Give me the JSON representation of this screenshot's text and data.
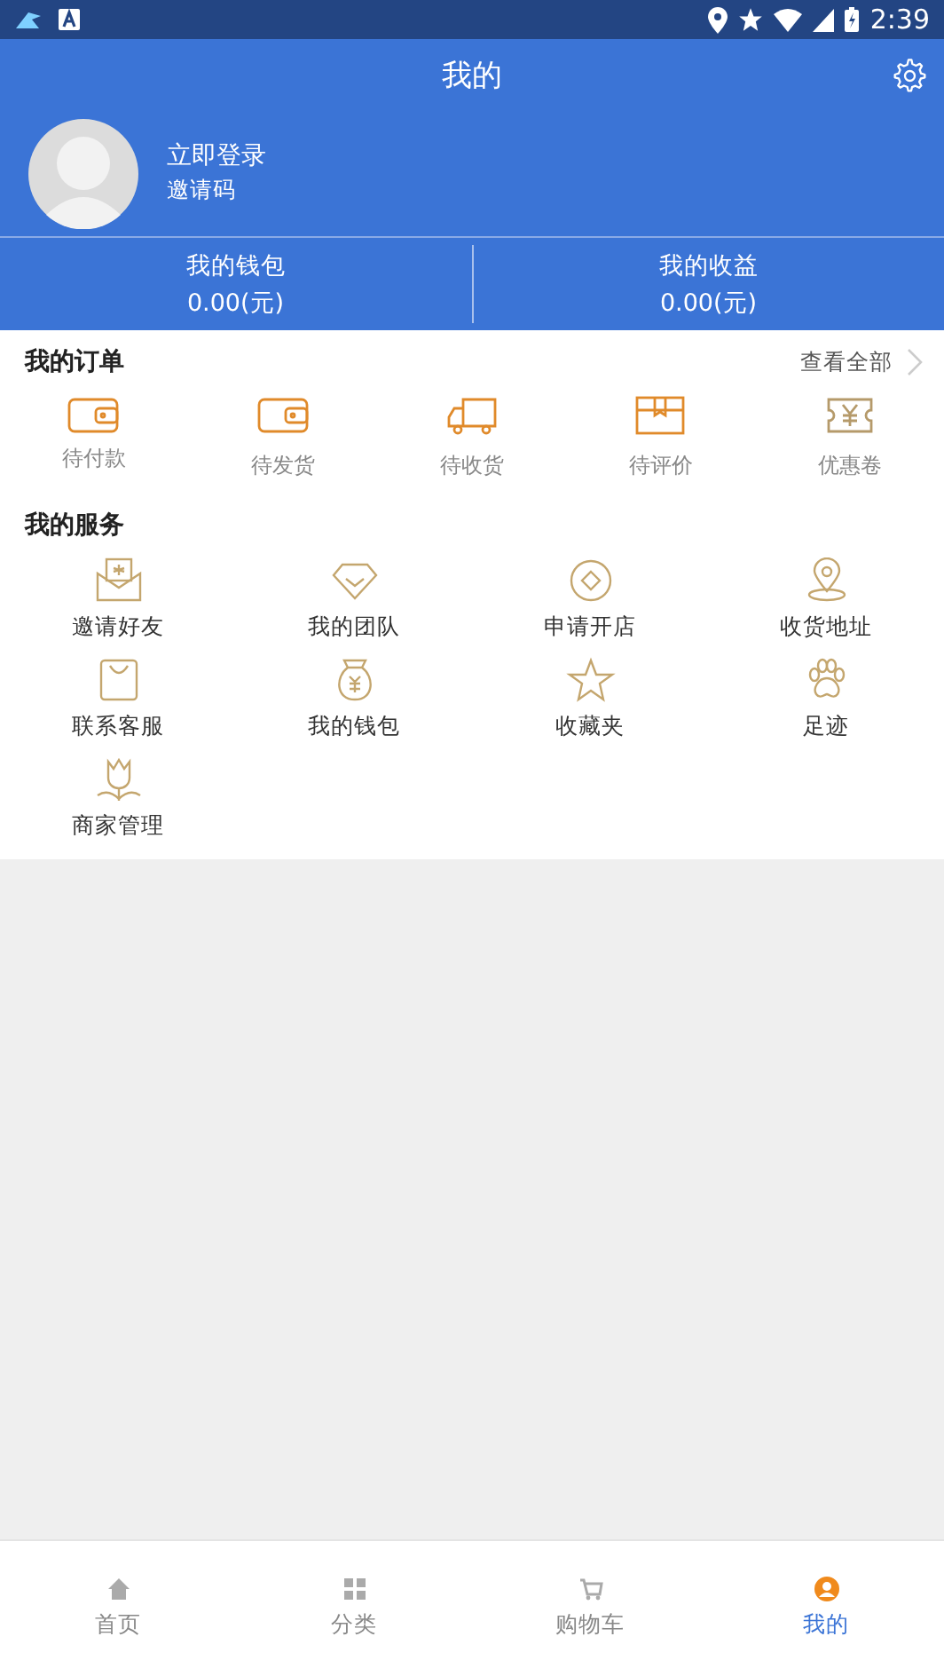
{
  "status_bar": {
    "time": "2:39"
  },
  "header": {
    "title": "我的"
  },
  "profile": {
    "login": "立即登录",
    "invite": "邀请码"
  },
  "balances": [
    {
      "label": "我的钱包",
      "value": "0.00(元)"
    },
    {
      "label": "我的收益",
      "value": "0.00(元)"
    }
  ],
  "orders": {
    "title": "我的订单",
    "view_all": "查看全部",
    "items": [
      {
        "label": "待付款"
      },
      {
        "label": "待发货"
      },
      {
        "label": "待收货"
      },
      {
        "label": "待评价"
      },
      {
        "label": "优惠卷"
      }
    ]
  },
  "services": {
    "title": "我的服务",
    "items": [
      {
        "label": "邀请好友"
      },
      {
        "label": "我的团队"
      },
      {
        "label": "申请开店"
      },
      {
        "label": "收货地址"
      },
      {
        "label": "联系客服"
      },
      {
        "label": "我的钱包"
      },
      {
        "label": "收藏夹"
      },
      {
        "label": "足迹"
      },
      {
        "label": "商家管理"
      }
    ]
  },
  "tab_bar": [
    {
      "label": "首页",
      "selected": false
    },
    {
      "label": "分类",
      "selected": false
    },
    {
      "label": "购物车",
      "selected": false
    },
    {
      "label": "我的",
      "selected": true
    }
  ]
}
